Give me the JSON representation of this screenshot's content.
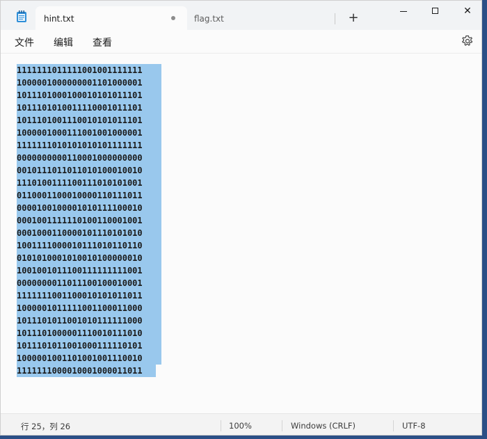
{
  "tabs": [
    {
      "label": "hint.txt",
      "modified": true
    },
    {
      "label": "flag.txt"
    }
  ],
  "new_tab_label": "+",
  "window_controls": {
    "close_label": "✕"
  },
  "menu": {
    "file": "文件",
    "edit": "编辑",
    "view": "查看"
  },
  "editor": {
    "selected": true,
    "lines": [
      "1111111011111001001111111",
      "1000001000000001101000001",
      "1011101000100010101011101",
      "1011101010011110001011101",
      "1011101001110010101011101",
      "1000001000111001001000001",
      "1111111010101010101111111",
      "0000000000110001000000000",
      "0010111011011010100010010",
      "1110100111100111010101001",
      "0110001100010000110111011",
      "0000100100001010111100010",
      "0001001111110100110001001",
      "0001000110000101110101010",
      "1001111000010111010110110",
      "0101010001010010100000010",
      "1001001011100111111111001",
      "0000000011011100100010001",
      "1111111001100010101011011",
      "1000001011111001100011000",
      "1011101011001010111111000",
      "1011101000001110010111010",
      "1011101011001000111110101",
      "1000001001101001001110010",
      "1111111000010001000011011"
    ]
  },
  "status": {
    "position": "行 25，列 26",
    "zoom": "100%",
    "line_ending": "Windows (CRLF)",
    "encoding": "UTF-8"
  },
  "colors": {
    "selection": "#99c8ed",
    "titlebar": "#f1f3f5",
    "desktop": "#2b4f86"
  }
}
